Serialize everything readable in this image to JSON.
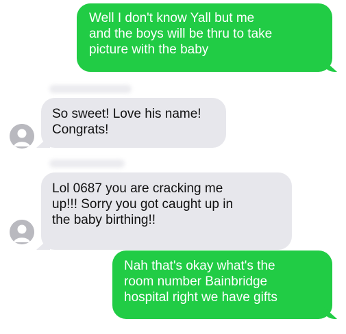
{
  "conversation": {
    "messages": [
      {
        "direction": "outgoing",
        "text": "Well I don't know Yall but me\nand the boys will be thru to take\npicture with the baby"
      },
      {
        "direction": "incoming",
        "text": "So sweet! Love his name!\nCongrats!"
      },
      {
        "direction": "incoming",
        "text": "Lol 0687 you are cracking me\nup!!! Sorry you got caught up in\nthe baby birthing!!"
      },
      {
        "direction": "outgoing",
        "text": "Nah that's okay what's the\nroom number Bainbridge\nhospital right we have gifts"
      }
    ]
  },
  "colors": {
    "outgoing_bubble": "#21cc45",
    "incoming_bubble": "#e7e7ec",
    "avatar": "#b9b9bf"
  },
  "icons": {
    "avatar": "person-silhouette-icon"
  }
}
